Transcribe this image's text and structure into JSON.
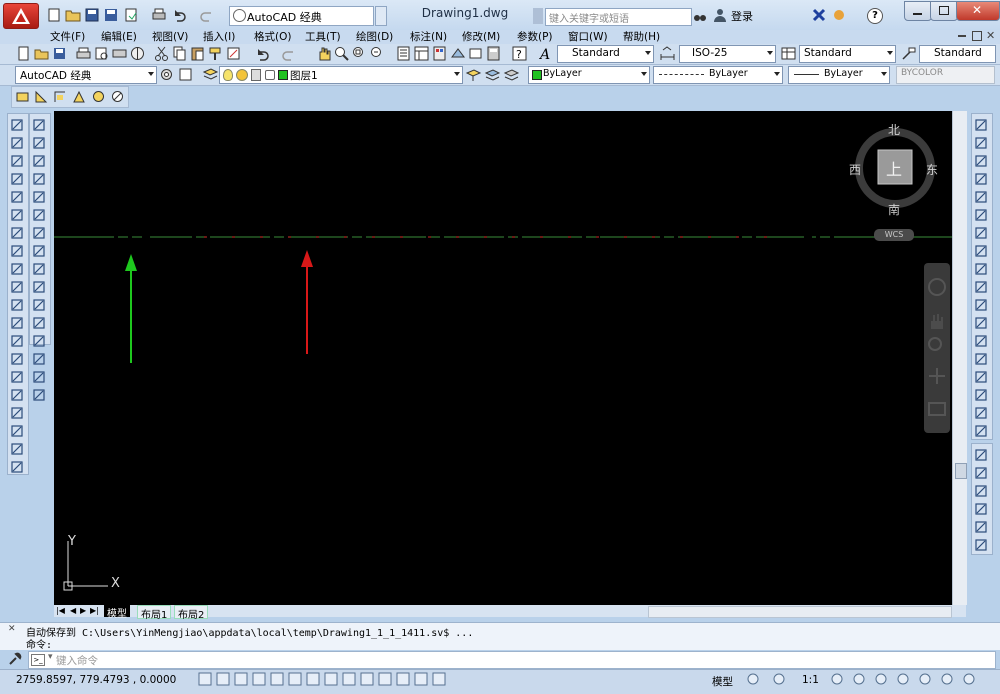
{
  "titlebar": {
    "workspace": "AutoCAD 经典",
    "document_title": "Drawing1.dwg",
    "search_placeholder": "键入关键字或短语",
    "login_label": "登录"
  },
  "menu": [
    "文件(F)",
    "编辑(E)",
    "视图(V)",
    "插入(I)",
    "格式(O)",
    "工具(T)",
    "绘图(D)",
    "标注(N)",
    "修改(M)",
    "参数(P)",
    "窗口(W)",
    "帮助(H)"
  ],
  "styles": {
    "text_style": "Standard",
    "dim_style": "ISO-25",
    "table_style": "Standard",
    "mleader_style": "Standard"
  },
  "layers": {
    "workspace_combo": "AutoCAD 经典",
    "current_layer": "图层1",
    "color": "ByLayer",
    "linetype": "ByLayer",
    "lineweight": "ByLayer",
    "plotstyle": "BYCOLOR"
  },
  "viewcube": {
    "north": "北",
    "south": "南",
    "east": "东",
    "west": "西",
    "face": "上",
    "wcs": "WCS"
  },
  "ucs": {
    "x_label": "X",
    "y_label": "Y"
  },
  "tabs": [
    "模型",
    "布局1",
    "布局2"
  ],
  "command": {
    "history_1": "自动保存到 C:\\Users\\YinMengjiao\\appdata\\local\\temp\\Drawing1_1_1_1411.sv$ ...",
    "history_2": "命令:",
    "input_placeholder": "键入命令"
  },
  "status": {
    "coordinates": "2759.8597, 779.4793 , 0.0000",
    "model_label": "模型",
    "scale": "1:1"
  },
  "colors": {
    "canvas": "#000000",
    "centerline": "#2f6f2f",
    "arrow_green": "#1ec81e",
    "arrow_red": "#d81818",
    "dash_red": "#8b1a1a"
  }
}
